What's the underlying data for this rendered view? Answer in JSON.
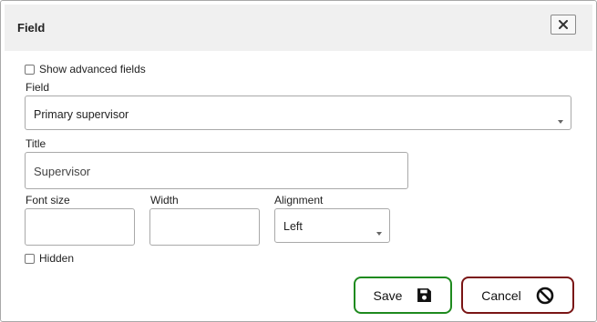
{
  "dialog": {
    "title": "Field",
    "close_icon": "close-x-icon"
  },
  "form": {
    "show_advanced_label": "Show advanced fields",
    "show_advanced_checked": false,
    "field_label": "Field",
    "field_value": "Primary supervisor",
    "title_label": "Title",
    "title_value": "Supervisor",
    "font_size_label": "Font size",
    "font_size_value": "",
    "width_label": "Width",
    "width_value": "",
    "alignment_label": "Alignment",
    "alignment_value": "Left",
    "hidden_label": "Hidden",
    "hidden_checked": false
  },
  "buttons": {
    "save_label": "Save",
    "save_icon": "floppy-disk-icon",
    "save_border": "#1e8a1e",
    "cancel_label": "Cancel",
    "cancel_icon": "prohibited-icon",
    "cancel_border": "#7a1515"
  }
}
